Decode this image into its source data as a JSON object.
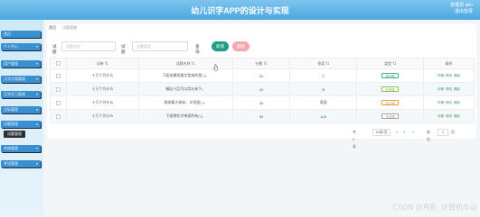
{
  "header": {
    "title": "幼儿识字APP的设计与实现",
    "user": "管理员 abo",
    "logout": "退出登录"
  },
  "sidebar": {
    "items": [
      {
        "label": "首页"
      },
      {
        "label": "个人中心"
      },
      {
        "label": "用户管理"
      },
      {
        "label": "汉字分类管理"
      },
      {
        "label": "汉字学习管理"
      },
      {
        "label": "达标管理"
      },
      {
        "label": "试题管理",
        "expanded": true
      },
      {
        "label": "系统管理"
      },
      {
        "label": "考试管理"
      }
    ],
    "submenu": [
      {
        "label": "试题管理"
      }
    ]
  },
  "breadcrumb": {
    "home": "首页",
    "current": "试题管理"
  },
  "filters": {
    "label1": "试题",
    "placeholder1": "试题名称",
    "label2": "试题",
    "placeholder2": "试题类型",
    "select_value": "查询",
    "add_label": "新增",
    "delete_label": "删除"
  },
  "table": {
    "headers": [
      "",
      "试卷",
      "试题名称",
      "分数",
      "答案",
      "类型",
      "操作"
    ],
    "rows": [
      {
        "paper": "十万个为什么",
        "name": "下面加横线量字是加的是(   )。",
        "score": "20",
        "answer": "C",
        "type": "单选题",
        "type_color": "#3fb27f"
      },
      {
        "paper": "十万个为什么",
        "name": "福娃小臣可以用水来下。",
        "score": "20",
        "answer": "B",
        "type": "判断题",
        "type_color": "#8cc152"
      },
      {
        "paper": "十万个为什么",
        "name": "地球最大球体，半径面(   )。",
        "score": "30",
        "answer": "表面",
        "type": "填空题",
        "type_color": "#e2a03f"
      },
      {
        "paper": "十万个为什么",
        "name": "下面哪些字带类的有(   )。",
        "score": "30",
        "answer": "A,B",
        "type": "多选题",
        "type_color": "#9e9e9e"
      }
    ],
    "ops": {
      "detail": "详情",
      "edit": "修改",
      "delete": "删除"
    }
  },
  "pager": {
    "total": "共 4 条",
    "per_page": "10条/页",
    "prev": "<",
    "page": "1",
    "next": ">",
    "goto": "前往",
    "goto_page": "1",
    "page_unit": "页"
  },
  "watermark": "CSDN @月影_计算机毕设"
}
